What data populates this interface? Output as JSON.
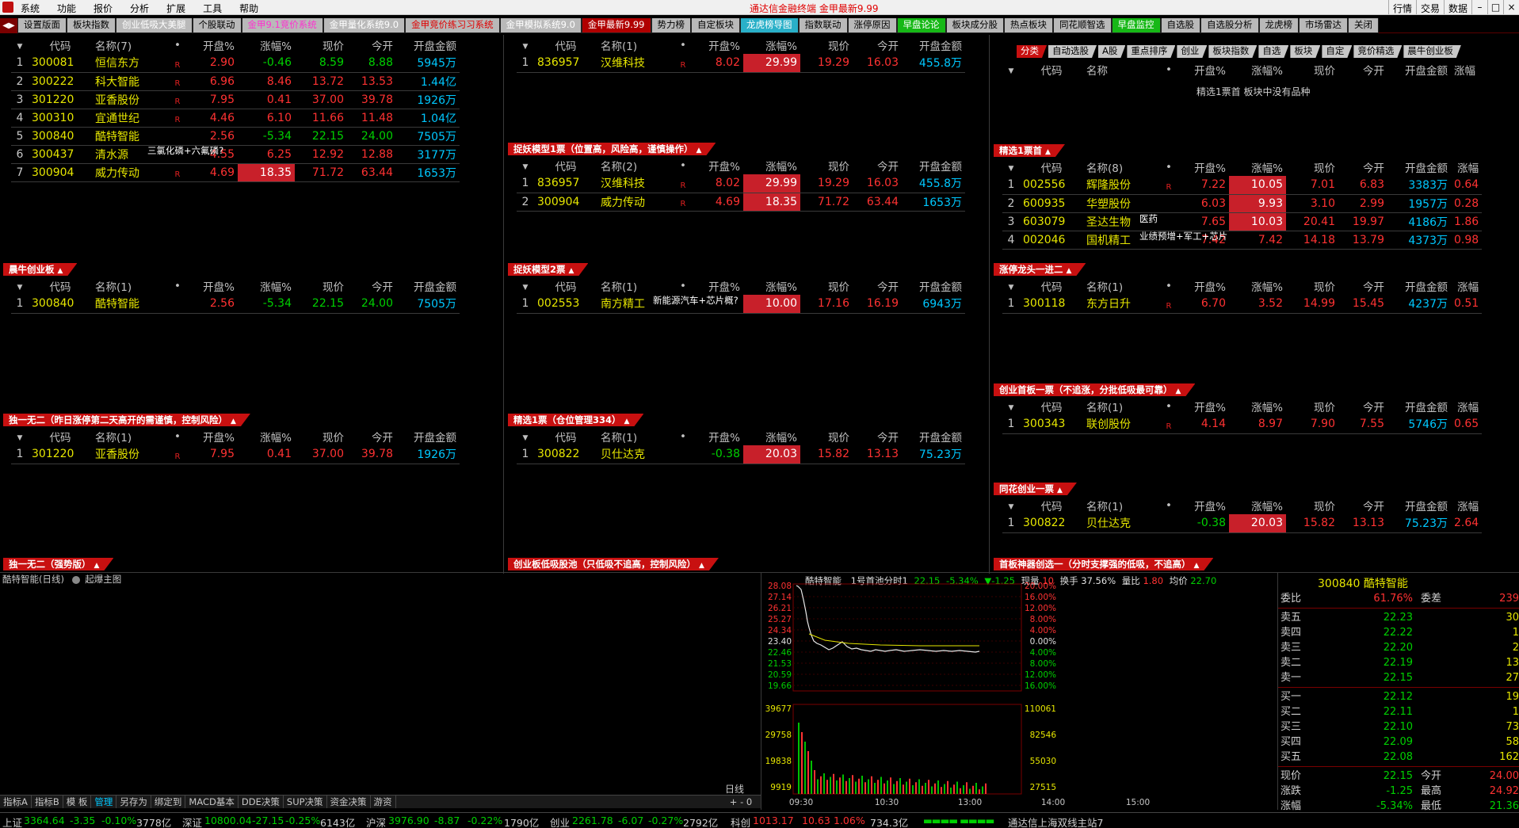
{
  "menubar": {
    "items": [
      "系统",
      "功能",
      "报价",
      "分析",
      "扩展",
      "工具",
      "帮助"
    ],
    "center_title": "通达信金融终端   金甲最新9.99",
    "right_buttons": [
      "行情",
      "交易",
      "数据"
    ]
  },
  "tabs": [
    {
      "label": "设置版面",
      "style": ""
    },
    {
      "label": "板块指数",
      "style": ""
    },
    {
      "label": "创业低吸大美腿",
      "style": "c-white"
    },
    {
      "label": "个股联动",
      "style": ""
    },
    {
      "label": "金甲9.1竞价系统",
      "style": "c-pink"
    },
    {
      "label": "金甲量化系统9.0",
      "style": "c-white"
    },
    {
      "label": "金甲竞价练习习系统",
      "style": "c-red"
    },
    {
      "label": "金甲模拟系统9.0",
      "style": "c-white"
    },
    {
      "label": "金甲最新9.99",
      "style": "active"
    },
    {
      "label": "势力榜",
      "style": ""
    },
    {
      "label": "自定板块",
      "style": ""
    },
    {
      "label": "龙虎榜导图",
      "style": "c-cyan"
    },
    {
      "label": "指数联动",
      "style": ""
    },
    {
      "label": "涨停原因",
      "style": ""
    },
    {
      "label": "早盘论论",
      "style": "c-green"
    },
    {
      "label": "板块成分股",
      "style": ""
    },
    {
      "label": "热点板块",
      "style": ""
    },
    {
      "label": "同花顺智选",
      "style": ""
    },
    {
      "label": "早盘监控",
      "style": "c-green"
    },
    {
      "label": "自选股",
      "style": ""
    },
    {
      "label": "自选股分析",
      "style": ""
    },
    {
      "label": "龙虎榜",
      "style": ""
    },
    {
      "label": "市场雷达",
      "style": ""
    },
    {
      "label": "关闭",
      "style": ""
    }
  ],
  "headers": {
    "code": "代码",
    "open_pct": "开盘%",
    "chg_pct": "涨幅%",
    "price": "现价",
    "today_open": "今开",
    "open_amt": "开盘金额"
  },
  "panels": {
    "p1": {
      "title": "",
      "name_header": "名称(7)",
      "rows": [
        {
          "idx": "1",
          "code": "300081",
          "name": "恒信东方",
          "flag": "R",
          "open": "2.90",
          "chg": "-0.46",
          "price": "8.59",
          "topen": "8.88",
          "amt": "5945万"
        },
        {
          "idx": "2",
          "code": "300222",
          "name": "科大智能",
          "flag": "R",
          "open": "6.96",
          "chg": "8.46",
          "price": "13.72",
          "topen": "13.53",
          "amt": "1.44亿"
        },
        {
          "idx": "3",
          "code": "301220",
          "name": "亚香股份",
          "flag": "R",
          "open": "7.95",
          "chg": "0.41",
          "price": "37.00",
          "topen": "39.78",
          "amt": "1926万"
        },
        {
          "idx": "4",
          "code": "300310",
          "name": "宜通世纪",
          "flag": "R",
          "open": "4.46",
          "chg": "6.10",
          "price": "11.66",
          "topen": "11.48",
          "amt": "1.04亿"
        },
        {
          "idx": "5",
          "code": "300840",
          "name": "酷特智能",
          "flag": "",
          "open": "2.56",
          "chg": "-5.34",
          "price": "22.15",
          "topen": "24.00",
          "amt": "7505万"
        },
        {
          "idx": "6",
          "code": "300437",
          "name": "清水源",
          "flag": "",
          "open": "4.55",
          "chg": "6.25",
          "price": "12.92",
          "topen": "12.88",
          "amt": "3177万"
        },
        {
          "idx": "7",
          "code": "300904",
          "name": "威力传动",
          "flag": "R",
          "open": "4.69",
          "chg": "18.35",
          "price": "71.72",
          "topen": "63.44",
          "amt": "1653万"
        }
      ],
      "note": "三氯化磷+六氟磷?"
    },
    "p2": {
      "title": "",
      "name_header": "名称(1)",
      "rows": [
        {
          "idx": "1",
          "code": "836957",
          "name": "汉维科技",
          "flag": "R",
          "open": "8.02",
          "chg": "29.99",
          "price": "19.29",
          "topen": "16.03",
          "amt": "455.8万"
        }
      ]
    },
    "p3": {
      "title": "分类",
      "name_header": "名称",
      "rows": [],
      "empty_note": "精选1票首 板块中没有品种"
    },
    "p4": {
      "title": "捉妖模型1票（位置高，风险高，谨慎操作）",
      "name_header": "名称(2)",
      "rows": [
        {
          "idx": "1",
          "code": "836957",
          "name": "汉维科技",
          "flag": "R",
          "open": "8.02",
          "chg": "29.99",
          "price": "19.29",
          "topen": "16.03",
          "amt": "455.8万"
        },
        {
          "idx": "2",
          "code": "300904",
          "name": "威力传动",
          "flag": "R",
          "open": "4.69",
          "chg": "18.35",
          "price": "71.72",
          "topen": "63.44",
          "amt": "1653万"
        }
      ]
    },
    "p5": {
      "title": "精选1票首",
      "name_header": "名称(8)",
      "rows": [
        {
          "idx": "1",
          "code": "002556",
          "name": "辉隆股份",
          "flag": "R",
          "open": "7.22",
          "chg": "10.05",
          "price": "7.01",
          "topen": "6.83",
          "amt": "3383万",
          "extra": "0.64"
        },
        {
          "idx": "2",
          "code": "600935",
          "name": "华塑股份",
          "flag": "",
          "open": "6.03",
          "chg": "9.93",
          "price": "3.10",
          "topen": "2.99",
          "amt": "1957万",
          "extra": "0.28"
        },
        {
          "idx": "3",
          "code": "603079",
          "name": "圣达生物",
          "flag": "",
          "open": "7.65",
          "chg": "10.03",
          "price": "20.41",
          "topen": "19.97",
          "amt": "4186万",
          "extra": "1.86"
        },
        {
          "idx": "4",
          "code": "002046",
          "name": "国机精工",
          "flag": "",
          "open": "7.42",
          "chg": "7.42",
          "price": "14.18",
          "topen": "13.79",
          "amt": "4373万",
          "extra": "0.98"
        }
      ],
      "note1": "医药",
      "note2": "业绩预增+军工+芯片"
    },
    "p6": {
      "title": "晨牛创业板",
      "name_header": "名称(1)",
      "rows": [
        {
          "idx": "1",
          "code": "300840",
          "name": "酷特智能",
          "flag": "",
          "open": "2.56",
          "chg": "-5.34",
          "price": "22.15",
          "topen": "24.00",
          "amt": "7505万"
        }
      ]
    },
    "p7": {
      "title": "捉妖模型2票",
      "name_header": "名称(1)",
      "rows": [
        {
          "idx": "1",
          "code": "002553",
          "name": "南方精工",
          "flag": "",
          "open": "",
          "chg": "10.00",
          "price": "17.16",
          "topen": "16.19",
          "amt": "6943万"
        }
      ],
      "note": "新能源汽车+芯片概?"
    },
    "p8": {
      "title": "涨停龙头一进二",
      "name_header": "名称(1)",
      "rows": [
        {
          "idx": "1",
          "code": "300118",
          "name": "东方日升",
          "flag": "R",
          "open": "6.70",
          "chg": "3.52",
          "price": "14.99",
          "topen": "15.45",
          "amt": "4237万",
          "extra": "0.51"
        }
      ]
    },
    "p9": {
      "title": "创业首板一票（不追涨，分批低吸最可靠）",
      "name_header": "名称(1)",
      "rows": [
        {
          "idx": "1",
          "code": "300343",
          "name": "联创股份",
          "flag": "R",
          "open": "4.14",
          "chg": "8.97",
          "price": "7.90",
          "topen": "7.55",
          "amt": "5746万",
          "extra": "0.65"
        }
      ]
    },
    "p10": {
      "title": "独一无二（昨日涨停第二天高开的需谨慎，控制风险）",
      "name_header": "名称(1)",
      "rows": [
        {
          "idx": "1",
          "code": "301220",
          "name": "亚香股份",
          "flag": "R",
          "open": "7.95",
          "chg": "0.41",
          "price": "37.00",
          "topen": "39.78",
          "amt": "1926万"
        }
      ]
    },
    "p11": {
      "title": "精选1票（仓位管理334）",
      "name_header": "名称(1)",
      "rows": [
        {
          "idx": "1",
          "code": "300822",
          "name": "贝仕达克",
          "flag": "",
          "open": "-0.38",
          "chg": "20.03",
          "price": "15.82",
          "topen": "13.13",
          "amt": "75.23万"
        }
      ]
    },
    "p12": {
      "title": "同花创业一票",
      "name_header": "名称(1)",
      "rows": [
        {
          "idx": "1",
          "code": "300822",
          "name": "贝仕达克",
          "flag": "",
          "open": "-0.38",
          "chg": "20.03",
          "price": "15.82",
          "topen": "13.13",
          "amt": "75.23万",
          "extra": "2.64"
        }
      ]
    },
    "bottom_titles": [
      "独一无二（强势版）",
      "创业板低吸股池（只低吸不追高，控制风险）",
      "首板神器创选一（分时支撑强的低吸，不追高）"
    ]
  },
  "right_subbar": [
    "分类",
    "自动选股",
    "A股",
    "重点排序",
    "创业",
    "板块指数",
    "自选",
    "板块",
    "自定",
    "竞价精选",
    "晨牛创业板"
  ],
  "right_extra_header": "涨幅",
  "kline": {
    "label": "酷特智能(日线)",
    "overlay": "起爆主图",
    "tools": [
      "指标A",
      "指标B",
      "模 板",
      "管理",
      "另存为",
      "绑定到",
      "MACD基本",
      "DDE决策",
      "SUP决策",
      "资金决策",
      "游资"
    ],
    "rixian": "日线",
    "plusminus": "+ - 0"
  },
  "minute": {
    "name": "酷特智能",
    "pool": "1号首池分时1",
    "price": "22.15",
    "chg_pct": "-5.34%",
    "chg": "▼-1.25",
    "vol_label": "现量",
    "vol": "10",
    "turn_label": "换手",
    "turn": "37.56%",
    "ratio_label": "量比",
    "ratio": "1.80",
    "avg_label": "均价",
    "avg": "22.70",
    "price_ticks": [
      "28.08",
      "27.14",
      "26.21",
      "25.27",
      "24.34",
      "23.40",
      "22.46",
      "21.53",
      "20.59",
      "19.66"
    ],
    "pct_ticks": [
      "20.00%",
      "16.00%",
      "12.00%",
      "8.00%",
      "4.00%",
      "0.00%",
      "4.00%",
      "8.00%",
      "12.00%",
      "16.00%"
    ],
    "vol_ticks": [
      "39677",
      "29758",
      "19838",
      "9919"
    ],
    "vol_ticks_r": [
      "110061",
      "82546",
      "55030",
      "27515"
    ],
    "time_ticks": [
      "09:30",
      "10:30",
      "13:00",
      "14:00",
      "15:00"
    ]
  },
  "quote": {
    "header": "300840 酷特智能",
    "webi_label": "委比",
    "webi": "61.76%",
    "weicha_label": "委差",
    "weicha": "239",
    "asks": [
      {
        "label": "卖五",
        "price": "22.23",
        "vol": "30"
      },
      {
        "label": "卖四",
        "price": "22.22",
        "vol": "1"
      },
      {
        "label": "卖三",
        "price": "22.20",
        "vol": "2"
      },
      {
        "label": "卖二",
        "price": "22.19",
        "vol": "13"
      },
      {
        "label": "卖一",
        "price": "22.15",
        "vol": "27"
      }
    ],
    "bids": [
      {
        "label": "买一",
        "price": "22.12",
        "vol": "19"
      },
      {
        "label": "买二",
        "price": "22.11",
        "vol": "1"
      },
      {
        "label": "买三",
        "price": "22.10",
        "vol": "73"
      },
      {
        "label": "买四",
        "price": "22.09",
        "vol": "58"
      },
      {
        "label": "买五",
        "price": "22.08",
        "vol": "162"
      }
    ],
    "stats": [
      {
        "k": "现价",
        "v": "22.15",
        "k2": "今开",
        "v2": "24.00"
      },
      {
        "k": "涨跌",
        "v": "-1.25",
        "k2": "最高",
        "v2": "24.92"
      },
      {
        "k": "涨幅",
        "v": "-5.34%",
        "k2": "最低",
        "v2": "21.36"
      }
    ]
  },
  "status": {
    "sh_label": "上证",
    "sh": "3364.64",
    "sh_chg": "-3.35",
    "sh_pct": "-0.10%",
    "sh_amt": "3778亿",
    "sz_label": "深证",
    "sz": "10800.04",
    "sz_chg": "-27.15",
    "sz_pct": "-0.25%",
    "sz_amt": "6143亿",
    "hs_label": "沪深",
    "hs": "3976.90",
    "hs_chg": "-8.87",
    "hs_pct": "-0.22%",
    "hs_amt": "1790亿",
    "cy_label": "创业",
    "cy": "2261.78",
    "cy_chg": "-6.07",
    "cy_pct": "-0.27%",
    "cy_amt": "2792亿",
    "kc_label": "科创",
    "kc": "1013.17",
    "kc_chg": "10.63",
    "kc_pct": "1.06%",
    "kc_amt": "734.3亿",
    "conn": "通达信上海双线主站7"
  }
}
